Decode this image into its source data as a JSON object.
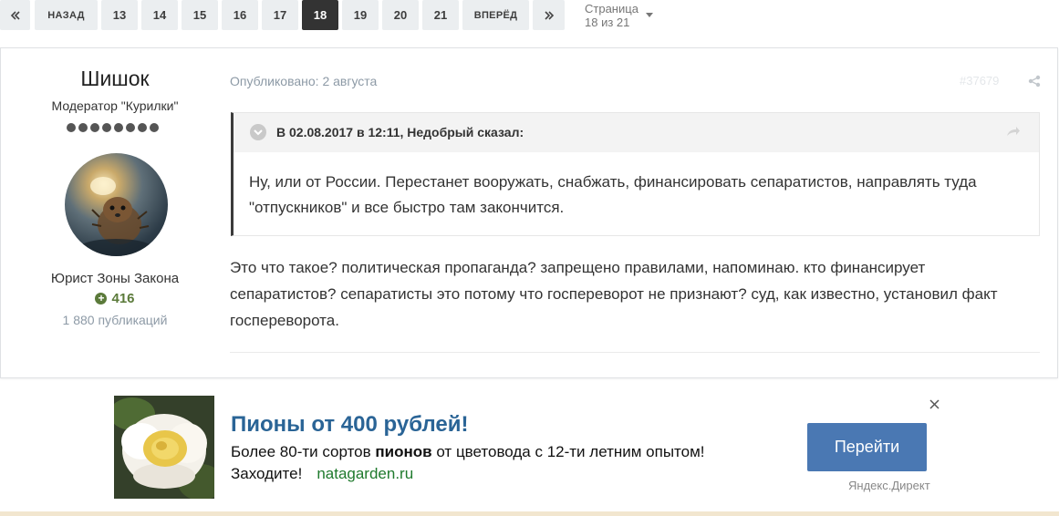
{
  "pagination": {
    "first_icon": "double-chevron-left-icon",
    "back_label": "НАЗАД",
    "pages": [
      "13",
      "14",
      "15",
      "16",
      "17",
      "18",
      "19",
      "20",
      "21"
    ],
    "current_page": "18",
    "forward_label": "ВПЕРЁД",
    "last_icon": "double-chevron-right-icon",
    "page_info": "Страница 18 из 21"
  },
  "post": {
    "author": {
      "name": "Шишок",
      "group": "Модератор \"Курилки\"",
      "rank_pips": 8,
      "title": "Юрист Зоны Закона",
      "reputation": "416",
      "post_count": "1 880 публикаций"
    },
    "published": "Опубликовано: 2 августа",
    "post_number": "#37679",
    "quote": {
      "citation": "В 02.08.2017 в 12:11, Недобрый сказал:",
      "text": "Ну, или от России. Перестанет вооружать, снабжать, финансировать сепаратистов, направлять туда \"отпускников\" и все быстро там закончится."
    },
    "text": "Это что такое? политическая пропаганда? запрещено правилами, напоминаю. кто финансирует сепаратистов? сепаратисты это потому что госпереворот не признают? суд, как известно, установил факт госпереворота."
  },
  "ad": {
    "title": "Пионы от 400 рублей!",
    "line1_before": "Более 80-ти сортов ",
    "line1_bold": "пионов",
    "line1_after": " от цветовода с 12-ти летним опытом!",
    "line2": "Заходите!",
    "domain": "natagarden.ru",
    "button_label": "Перейти",
    "source": "Яндекс.Директ"
  },
  "colors": {
    "accent": "#2a6496",
    "button": "#4a78b3",
    "reputation": "#5b7a3a",
    "pager_active": "#333333"
  }
}
